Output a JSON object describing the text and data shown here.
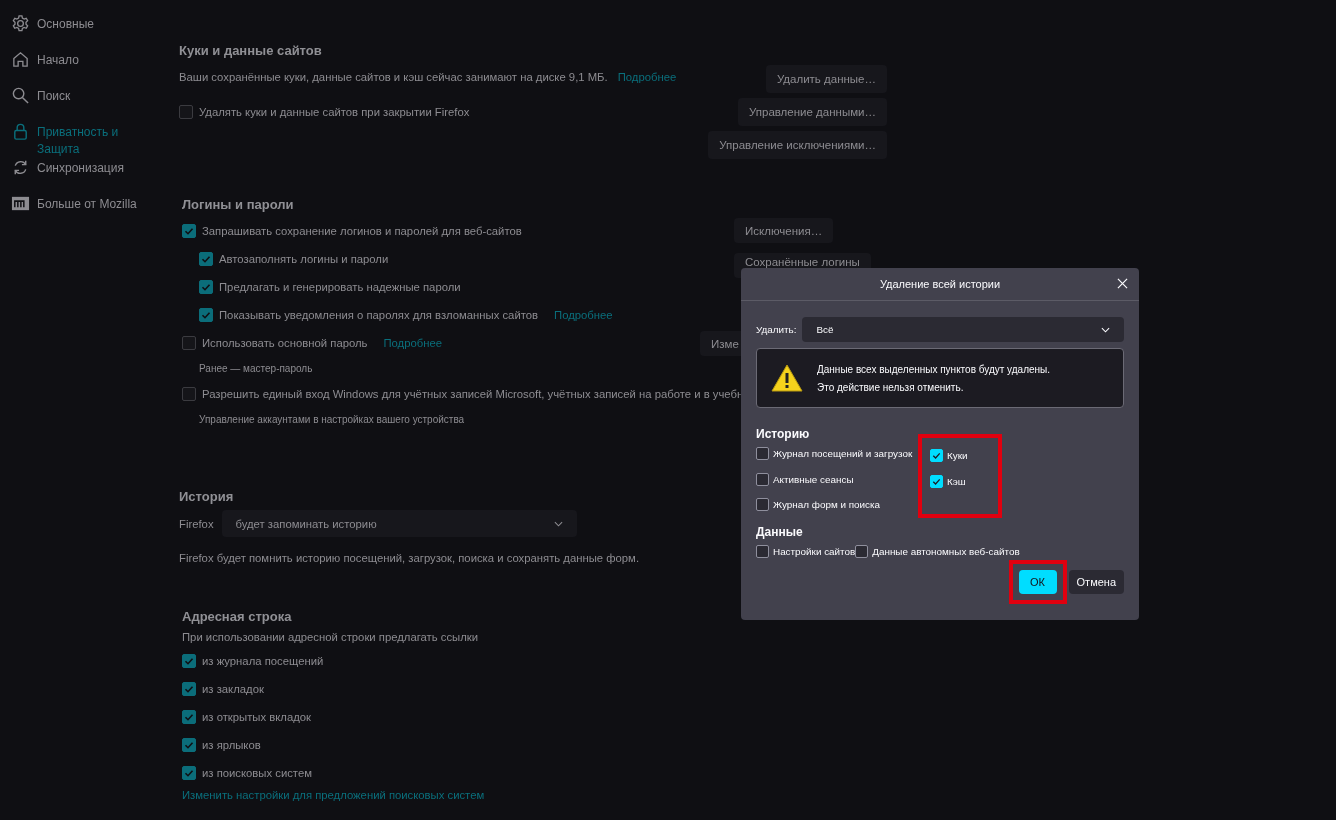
{
  "sidebar": {
    "items": [
      {
        "label": "Основные",
        "selected": false
      },
      {
        "label": "Начало",
        "selected": false
      },
      {
        "label": "Поиск",
        "selected": false
      },
      {
        "label": "Приватность и Защита",
        "selected": true
      },
      {
        "label": "Синхронизация",
        "selected": false
      },
      {
        "label": "Больше от Mozilla",
        "selected": false
      }
    ]
  },
  "cookies": {
    "title": "Куки и данные сайтов",
    "description": "Ваши сохранённые куки, данные сайтов и кэш сейчас занимают на диске 9,1 МБ.",
    "link": "Подробнее",
    "checkbox": {
      "label": "Удалять куки и данные сайтов при закрытии Firefox",
      "checked": false
    },
    "buttons": [
      "Удалить данные…",
      "Управление данными…",
      "Управление исключениями…"
    ]
  },
  "logins": {
    "title": "Логины и пароли",
    "options": [
      {
        "label": "Запрашивать сохранение логинов и паролей для веб-сайтов",
        "checked": true,
        "button": "Исключения…",
        "children": [
          {
            "label": "Автозаполнять логины и пароли",
            "checked": true,
            "button": "Сохранённые логины"
          },
          {
            "label": "Предлагать и генерировать надежные пароли",
            "checked": true
          },
          {
            "label": "Показывать уведомления о паролях для взломанных сайтов",
            "checked": true,
            "link": "Подробнее"
          }
        ]
      },
      {
        "label": "Использовать основной пароль",
        "checked": false,
        "link": "Подробнее",
        "button": "Изме",
        "note": "Ранее — мастер-пароль"
      },
      {
        "label": "Разрешить единый вход Windows для учётных записей Microsoft, учётных записей на работе и в учебн",
        "checked": false,
        "note": "Управление аккаунтами в настройках вашего устройства"
      }
    ]
  },
  "history": {
    "title": "История",
    "label": "Firefox",
    "select": {
      "value": "будет запоминать историю"
    },
    "description": "Firefox будет помнить историю посещений, загрузок, поиска и сохранять данные форм."
  },
  "address_bar": {
    "title": "Адресная строка",
    "description": "При использовании адресной строки предлагать ссылки",
    "options": [
      {
        "label": "из журнала посещений",
        "checked": true
      },
      {
        "label": "из закладок",
        "checked": true
      },
      {
        "label": "из открытых вкладок",
        "checked": true
      },
      {
        "label": "из ярлыков",
        "checked": true
      },
      {
        "label": "из поисковых систем",
        "checked": true
      }
    ],
    "link": "Изменить настройки для предложений поисковых систем"
  },
  "dialog": {
    "title": "Удаление всей истории",
    "range_label": "Удалить:",
    "range": {
      "value": "Всё"
    },
    "warning": [
      "Данные всех выделенных пунктов будут удалены.",
      "Это действие нельзя отменить."
    ],
    "history": {
      "title": "Историю",
      "columns": [
        {
          "highlighted": false,
          "items": [
            {
              "label": "Журнал посещений и загрузок",
              "checked": false
            },
            {
              "label": "Активные сеансы",
              "checked": false
            },
            {
              "label": "Журнал форм и поиска",
              "checked": false
            }
          ]
        },
        {
          "highlighted": true,
          "items": [
            {
              "label": "Куки",
              "checked": true
            },
            {
              "label": "Кэш",
              "checked": true
            }
          ]
        }
      ]
    },
    "data": {
      "title": "Данные",
      "items": [
        {
          "label": "Настройки сайтов",
          "checked": false
        },
        {
          "label": "Данные автономных веб-сайтов",
          "checked": false
        }
      ]
    },
    "buttons": [
      {
        "label": "ОК",
        "kind": "primary",
        "highlighted": true
      },
      {
        "label": "Отмена",
        "kind": "secondary",
        "highlighted": false
      }
    ]
  }
}
